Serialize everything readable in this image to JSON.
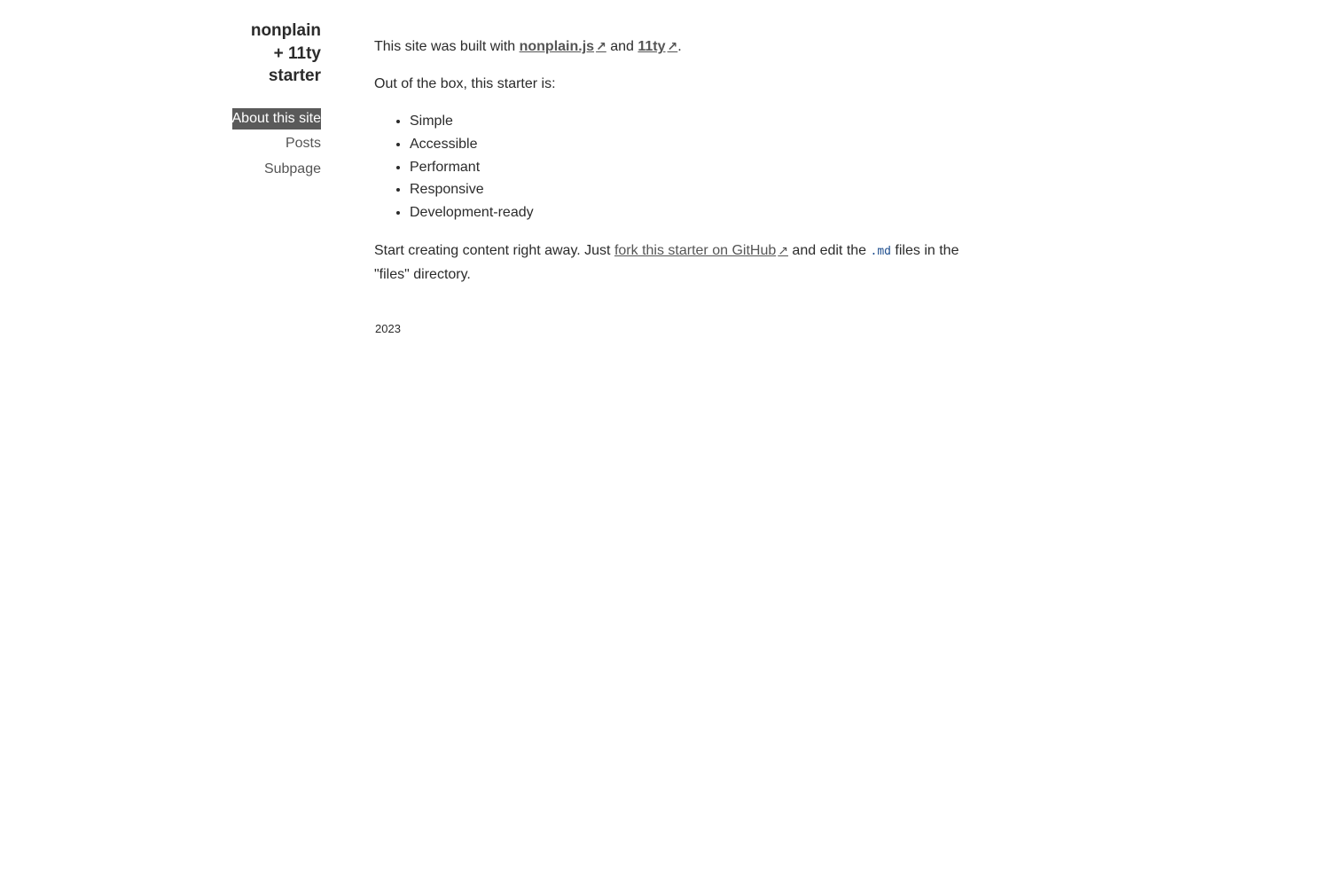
{
  "site": {
    "title_line1": "nonplain",
    "title_line2": "+ 11ty",
    "title_line3": "starter"
  },
  "nav": {
    "items": [
      {
        "label": "About this site",
        "active": true
      },
      {
        "label": "Posts",
        "active": false
      },
      {
        "label": "Subpage",
        "active": false
      }
    ]
  },
  "content": {
    "intro_prefix": "This site was built with ",
    "link_nonplain": "nonplain.js",
    "intro_and": " and ",
    "link_11ty": "11ty",
    "intro_suffix": ".",
    "external_arrow": "↗",
    "list_intro": "Out of the box, this starter is:",
    "features": [
      "Simple",
      "Accessible",
      "Performant",
      "Responsive",
      "Development-ready"
    ],
    "cta_prefix": "Start creating content right away. Just ",
    "link_fork": "fork this starter on GitHub",
    "cta_middle": " and edit the ",
    "code_ext": ".md",
    "cta_suffix": " files in the \"files\" directory."
  },
  "footer": {
    "year": "2023"
  }
}
